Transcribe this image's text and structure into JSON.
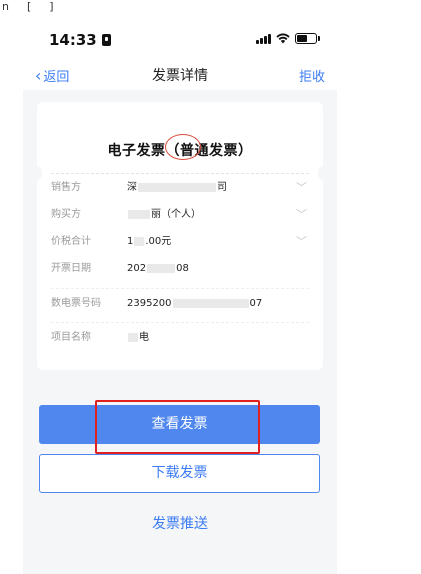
{
  "top_fragment": {
    "left": "n",
    "mid": "[",
    "right": "]"
  },
  "status": {
    "time": "14:33"
  },
  "nav": {
    "back_label": "返回",
    "title": "发票详情",
    "reject_label": "拒收"
  },
  "invoice": {
    "title": "电子发票（普通发票）",
    "rows": [
      {
        "label": "销售方",
        "value_prefix": "深",
        "value_suffix": "司",
        "expandable": true
      },
      {
        "label": "购买方",
        "value_prefix": "",
        "value_suffix": "丽（个人）",
        "expandable": true
      },
      {
        "label": "价税合计",
        "value_prefix": "1",
        "value_suffix": ".00元",
        "expandable": true
      },
      {
        "label": "开票日期",
        "value_prefix": "202",
        "value_suffix": "08",
        "expandable": false
      },
      {
        "label": "数电票号码",
        "value_prefix": "2395200",
        "value_suffix": "07",
        "expandable": false
      },
      {
        "label": "项目名称",
        "value_prefix": "",
        "value_suffix": "电",
        "expandable": false
      }
    ]
  },
  "actions": {
    "view_label": "查看发票",
    "download_label": "下载发票",
    "push_label": "发票推送"
  },
  "colors": {
    "accent": "#4f87ef",
    "link": "#3b7cf5",
    "annotation_red": "#e02020"
  }
}
